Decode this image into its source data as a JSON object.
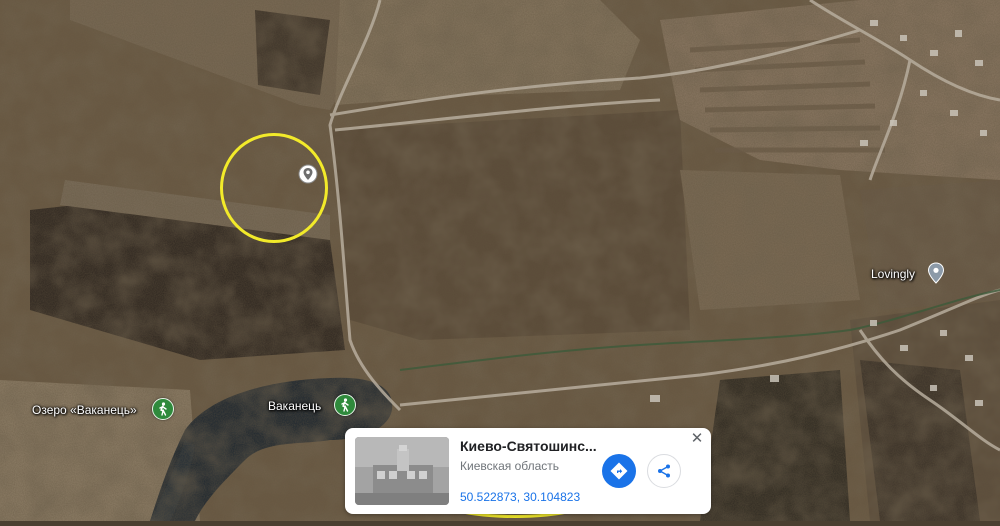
{
  "map": {
    "view": "satellite",
    "labels": [
      {
        "id": "lake",
        "text": "Озеро «Ваканець»"
      },
      {
        "id": "village",
        "text": "Ваканець"
      },
      {
        "id": "poi",
        "text": "Lovingly"
      }
    ],
    "poi_icon": "hiking-icon",
    "pin_icon": "location-pin-icon",
    "highlight_color": "#f2ea2a"
  },
  "card": {
    "title": "Киево-Святошинс...",
    "subtitle": "Киевская область",
    "coordinates": "50.522873, 30.104823",
    "close_icon": "close-icon",
    "directions_icon": "directions-icon",
    "share_icon": "share-icon",
    "accent_color": "#1a73e8"
  }
}
